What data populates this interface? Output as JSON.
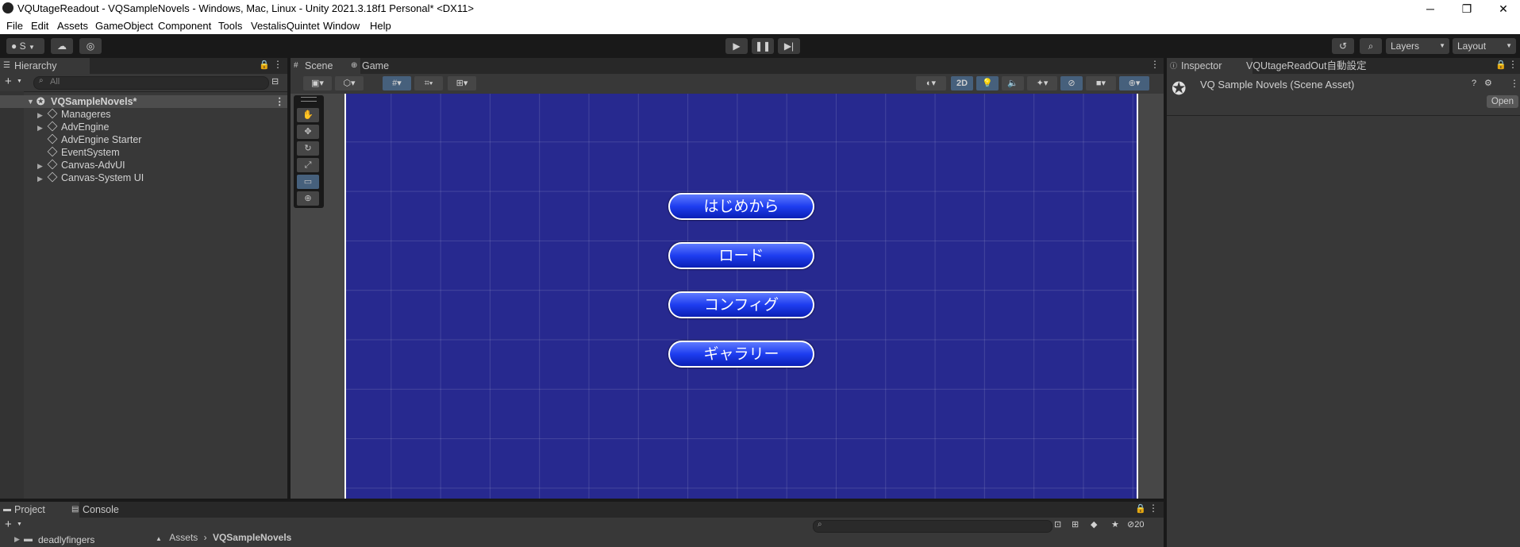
{
  "window": {
    "title": "VQUtageReadout - VQSampleNovels - Windows, Mac, Linux - Unity 2021.3.18f1 Personal* <DX11>",
    "minimize": "─",
    "maximize": "❐",
    "close": "✕"
  },
  "menu": [
    "File",
    "Edit",
    "Assets",
    "GameObject",
    "Component",
    "Tools",
    "VestalisQuintet",
    "Window",
    "Help"
  ],
  "toolbar": {
    "account_label": "S",
    "layers_label": "Layers",
    "layout_label": "Layout"
  },
  "hierarchy": {
    "tab": "Hierarchy",
    "search_placeholder": "All",
    "scene": "VQSampleNovels*",
    "items": [
      "Manageres",
      "AdvEngine",
      "AdvEngine Starter",
      "EventSystem",
      "Canvas-AdvUI",
      "Canvas-System UI"
    ]
  },
  "scene_tabs": {
    "scene": "Scene",
    "game": "Game",
    "mode_2d": "2D"
  },
  "game_menu": [
    "はじめから",
    "ロード",
    "コンフィグ",
    "ギャラリー"
  ],
  "inspector": {
    "tab": "Inspector",
    "tab2": "VQUtageReadOut自動設定",
    "asset_name": "VQ Sample Novels (Scene Asset)",
    "open_label": "Open"
  },
  "project": {
    "tab": "Project",
    "console_tab": "Console",
    "folder": "deadlyfingers",
    "breadcrumb_root": "Assets",
    "breadcrumb_current": "VQSampleNovels",
    "hidden_count": "20"
  },
  "colors": {
    "game_background": "#27298f",
    "button_blue": "#1e3df0",
    "selection": "#46607c"
  }
}
